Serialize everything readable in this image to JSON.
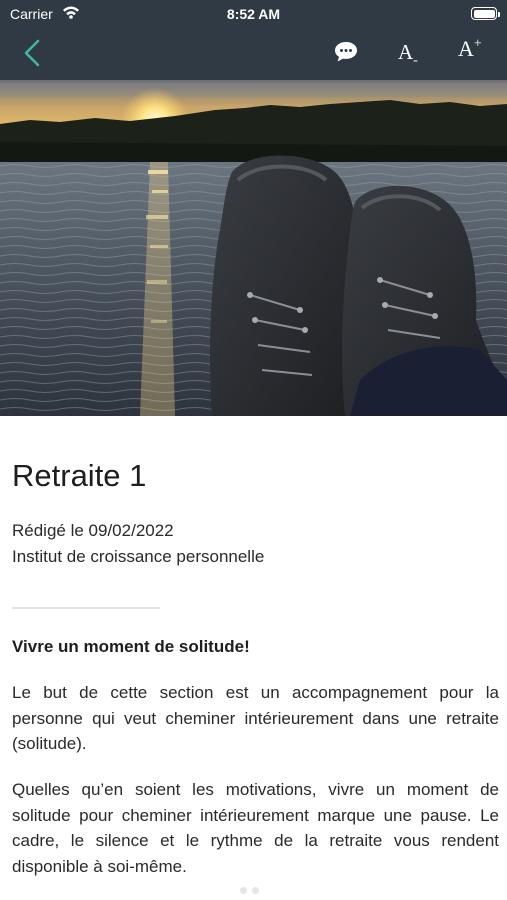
{
  "status_bar": {
    "carrier": "Carrier",
    "time": "8:52 AM"
  },
  "nav": {
    "icons": [
      "chevron-left-icon",
      "chat-bubble-icon"
    ],
    "font_decrease": {
      "letter": "A",
      "mark": "-"
    },
    "font_increase": {
      "letter": "A",
      "mark": "+"
    },
    "colors": {
      "bar": "#2f3a44",
      "back_accent": "#3fb8a2"
    }
  },
  "article": {
    "title": "Retraite 1",
    "date_line": "Rédigé le 09/02/2022",
    "author_line": "Institut de croissance personnelle",
    "subtitle": "Vivre un moment de solitude!",
    "paragraphs": [
      "Le but de cette section est un accompagnement pour la personne qui veut cheminer intérieurement dans une retraite (solitude).",
      "Quelles qu’en soient les motivations, vivre un moment de solitude pour cheminer intérieurement marque une pause. Le cadre, le silence et le rythme de la retraite vous rendent disponible à soi-même."
    ]
  },
  "pager": {
    "pages": 2,
    "current": 1
  }
}
